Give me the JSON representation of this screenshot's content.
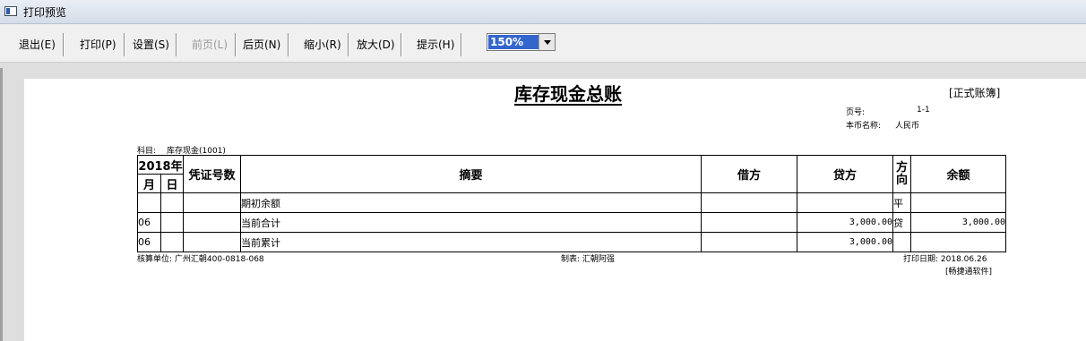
{
  "window": {
    "title": "打印预览"
  },
  "toolbar": {
    "buttons": [
      {
        "label": "退出(E)",
        "enabled": true
      },
      {
        "label": "打印(P)",
        "enabled": true
      },
      {
        "label": "设置(S)",
        "enabled": true
      },
      {
        "label": "前页(L)",
        "enabled": false
      },
      {
        "label": "后页(N)",
        "enabled": true
      },
      {
        "label": "缩小(R)",
        "enabled": true
      },
      {
        "label": "放大(D)",
        "enabled": true
      },
      {
        "label": "提示(H)",
        "enabled": true
      }
    ],
    "zoom": "150%"
  },
  "report": {
    "title": "库存现金总账",
    "badge": "[正式账簿]",
    "page_label": "页号:",
    "page_value": "1-1",
    "currency_label": "本币名称:",
    "currency_value": "人民币",
    "subject_label": "科目:",
    "subject_value": "库存现金(1001)",
    "table": {
      "year": "2018年",
      "month": "月",
      "day": "日",
      "voucher": "凭证号数",
      "summary": "摘要",
      "debit": "借方",
      "credit": "贷方",
      "direction": "方向",
      "balance": "余额",
      "rows": [
        {
          "month": "",
          "day": "",
          "voucher": "",
          "summary": "期初余额",
          "debit": "",
          "credit": "",
          "direction": "平",
          "balance": ""
        },
        {
          "month": "06",
          "day": "",
          "voucher": "",
          "summary": "当前合计",
          "debit": "",
          "credit": "3,000.00",
          "direction": "贷",
          "balance": "3,000.00"
        },
        {
          "month": "06",
          "day": "",
          "voucher": "",
          "summary": "当前累计",
          "debit": "",
          "credit": "3,000.00",
          "direction": "",
          "balance": ""
        }
      ]
    },
    "footer": {
      "unit": "核算单位: 广州汇朝400-0818-068",
      "maker": "制表: 汇朝阿强",
      "print_date": "打印日期: 2018.06.26",
      "software": "[畅捷通软件]"
    }
  }
}
